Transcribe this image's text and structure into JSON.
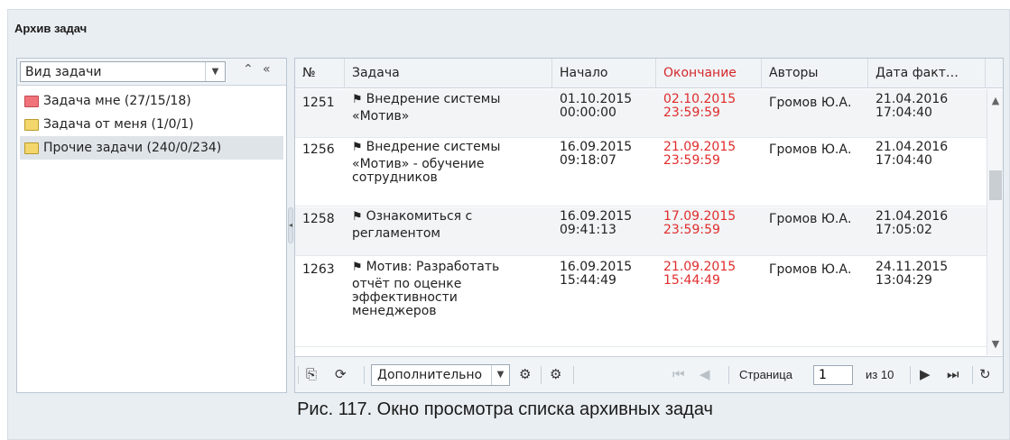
{
  "window": {
    "title": "Архив задач"
  },
  "left": {
    "combo_value": "Вид задачи",
    "tree": [
      {
        "label": "Задача мне (27/15/18)",
        "color": "#f0737a"
      },
      {
        "label": "Задача от меня (1/0/1)",
        "color": "#f3d66c"
      },
      {
        "label": "Прочие задачи (240/0/234)",
        "color": "#f3d66c",
        "selected": true
      }
    ]
  },
  "grid": {
    "columns": [
      "№",
      "Задача",
      "Начало",
      "Окончание",
      "Авторы",
      "Дата факт…"
    ],
    "rows": [
      {
        "num": "1251",
        "task_1": "Внедрение системы",
        "task_2": "«Мотив»",
        "start_date": "01.10.2015",
        "start_time": "00:00:00",
        "end_date": "02.10.2015",
        "end_time": "23:59:59",
        "author": "Громов Ю.А.",
        "fact_date": "21.04.2016",
        "fact_time": "17:04:40"
      },
      {
        "num": "1256",
        "task_1": "Внедрение системы",
        "task_2": "«Мотив» - обучение",
        "task_3": "сотрудников",
        "start_date": "16.09.2015",
        "start_time": "09:18:07",
        "end_date": "21.09.2015",
        "end_time": "23:59:59",
        "author": "Громов Ю.А.",
        "fact_date": "21.04.2016",
        "fact_time": "17:04:40"
      },
      {
        "num": "1258",
        "task_1": "Ознакомиться с",
        "task_2": "регламентом",
        "start_date": "16.09.2015",
        "start_time": "09:41:13",
        "end_date": "17.09.2015",
        "end_time": "23:59:59",
        "author": "Громов Ю.А.",
        "fact_date": "21.04.2016",
        "fact_time": "17:05:02"
      },
      {
        "num": "1263",
        "task_1": "Мотив: Разработать",
        "task_2": "отчёт по оценке",
        "task_3": "эффективности",
        "task_4": "менеджеров",
        "start_date": "16.09.2015",
        "start_time": "15:44:49",
        "end_date": "21.09.2015",
        "end_time": "15:44:49",
        "author": "Громов Ю.А.",
        "fact_date": "24.11.2015",
        "fact_time": "13:04:29"
      }
    ]
  },
  "footer": {
    "combo_value": "Дополнительно",
    "page_label": "Страница",
    "page_value": "1",
    "page_of": "из 10"
  },
  "caption": "Рис. 117. Окно просмотра списка архивных задач",
  "colors": {
    "overdue": "#e02c2c",
    "header_red": "#d5282c"
  }
}
